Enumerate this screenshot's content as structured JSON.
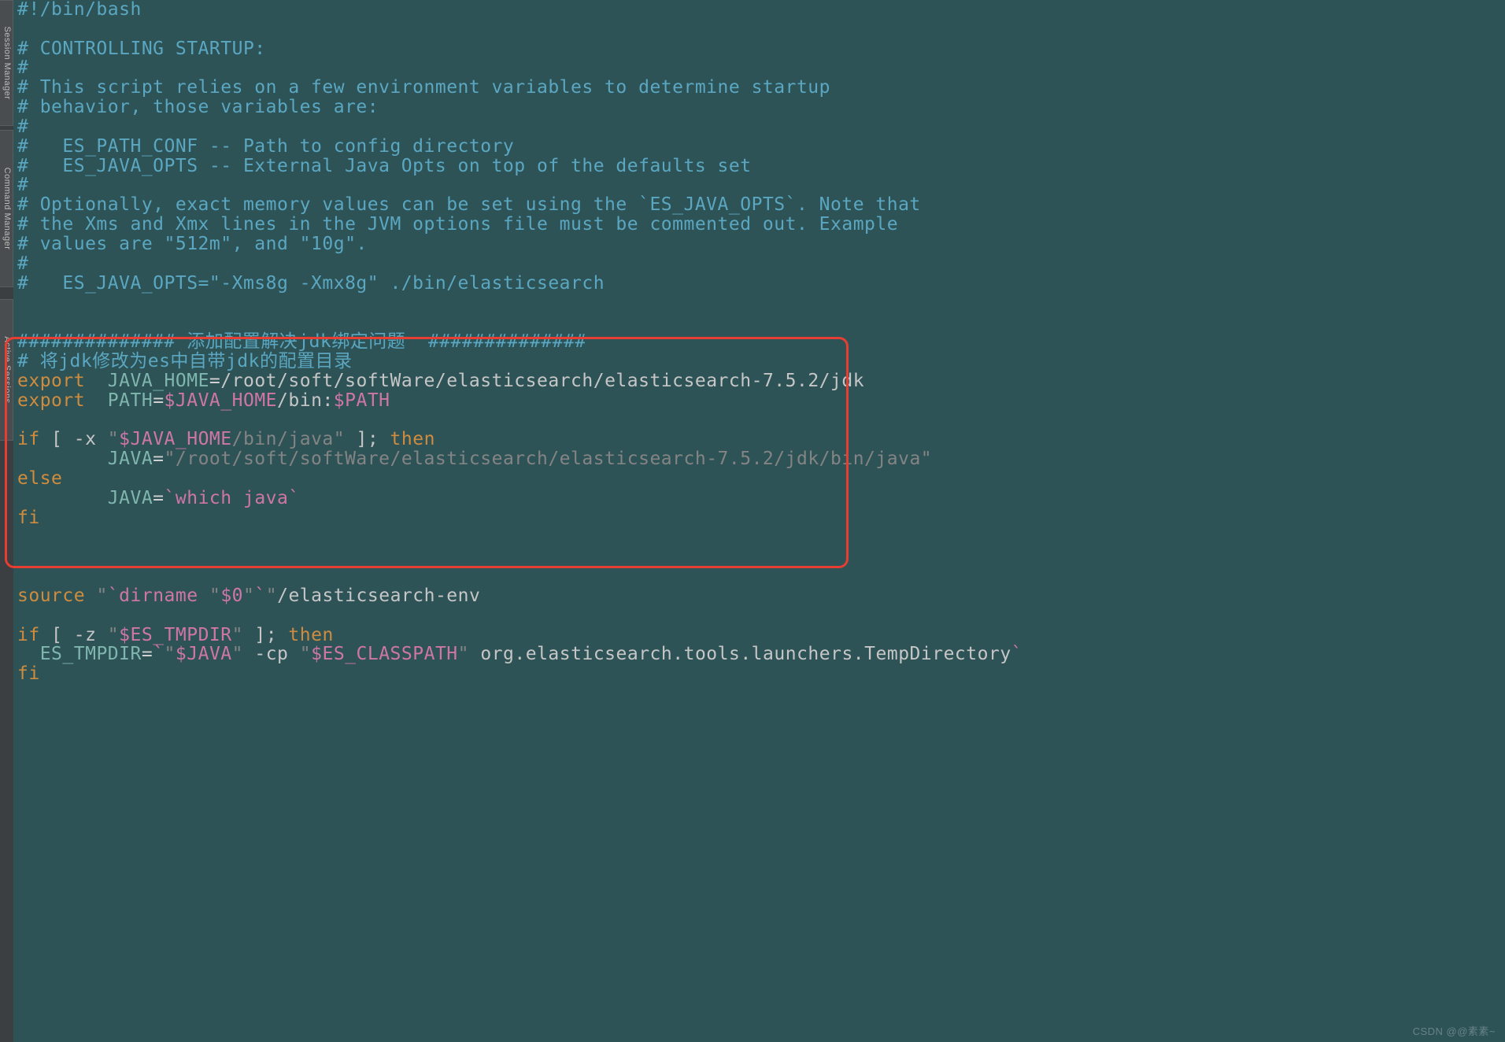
{
  "sidebar": {
    "tabs": [
      {
        "label": "Session Manager"
      },
      {
        "label": "Command Manager"
      },
      {
        "label": "Active Sessions"
      }
    ]
  },
  "code": {
    "l01": "#!/bin/bash",
    "l02": "",
    "l03": "# CONTROLLING STARTUP:",
    "l04": "#",
    "l05": "# This script relies on a few environment variables to determine startup",
    "l06": "# behavior, those variables are:",
    "l07": "#",
    "l08": "#   ES_PATH_CONF -- Path to config directory",
    "l09": "#   ES_JAVA_OPTS -- External Java Opts on top of the defaults set",
    "l10": "#",
    "l11": "# Optionally, exact memory values can be set using the `ES_JAVA_OPTS`. Note that",
    "l12": "# the Xms and Xmx lines in the JVM options file must be commented out. Example",
    "l13": "# values are \"512m\", and \"10g\".",
    "l14": "#",
    "l15": "#   ES_JAVA_OPTS=\"-Xms8g -Xmx8g\" ./bin/elasticsearch",
    "l16": "",
    "l17": "",
    "l18a": "############## ",
    "l18b": "添加配置解决jdk绑定问题",
    "l18c": "  ##############",
    "l19": "# 将jdk修改为es中自带jdk的配置目录",
    "l20_kw": "export",
    "l20_var": "  JAVA_HOME",
    "l20_eq": "=",
    "l20_val": "/root/soft/softWare/elasticsearch/elasticsearch-7.5.2/jdk",
    "l21_kw": "export",
    "l21_var": "  PATH",
    "l21_eq": "=",
    "l21_v1": "$JAVA_HOME",
    "l21_v2": "/bin:",
    "l21_v3": "$PATH",
    "l22": "",
    "l23_if": "if",
    "l23_op1": " [ ",
    "l23_opt": "-x ",
    "l23_q": "\"",
    "l23_jh": "$JAVA_HOME",
    "l23_pth": "/bin/java",
    "l23_op2": " ]",
    "l23_sc": "; ",
    "l23_then": "then",
    "l24_ind": "        ",
    "l24_var": "JAVA",
    "l24_eq": "=",
    "l24_str": "\"/root/soft/softWare/elasticsearch/elasticsearch-7.5.2/jdk/bin/java\"",
    "l25_else": "else",
    "l26_ind": "        ",
    "l26_var": "JAVA",
    "l26_eq": "=",
    "l26_bt": "`",
    "l26_which": "which java",
    "l27_fi": "fi",
    "l28": "",
    "l29": "",
    "l30": "",
    "l31_kw": "source",
    "l31_sp": " ",
    "l31_q1": "\"",
    "l31_bt": "`",
    "l31_dn": "dirname ",
    "l31_q2": "\"",
    "l31_0": "$0",
    "l31_q3": "\"",
    "l31_q4": "\"",
    "l31_rest": "/elasticsearch-env",
    "l32": "",
    "l33_if": "if",
    "l33_op1": " [ ",
    "l33_opt": "-z ",
    "l33_q": "\"",
    "l33_var": "$ES_TMPDIR",
    "l33_op2": " ]",
    "l33_sc": "; ",
    "l33_then": "then",
    "l34_ind": "  ",
    "l34_var": "ES_TMPDIR",
    "l34_eq": "=",
    "l34_bt": "`",
    "l34_q1": "\"",
    "l34_java": "$JAVA",
    "l34_q2": "\"",
    "l34_cp": " -cp ",
    "l34_q3": "\"",
    "l34_escp": "$ES_CLASSPATH",
    "l34_q4": "\"",
    "l34_rest": " org.elasticsearch.tools.launchers.TempDirectory",
    "l35_fi": "fi"
  },
  "watermark": "CSDN @@素素~"
}
